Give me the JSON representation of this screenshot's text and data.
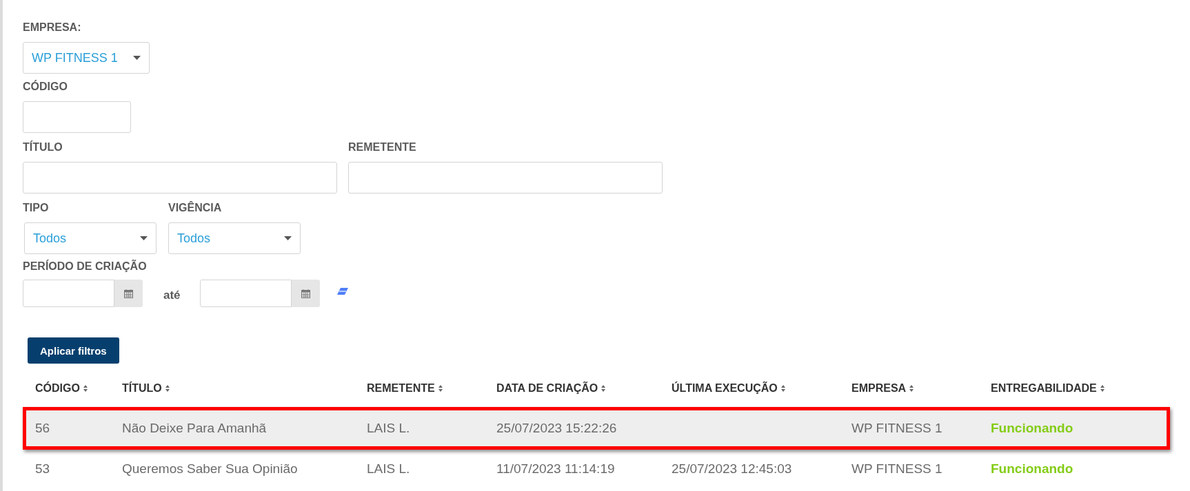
{
  "filters": {
    "empresa": {
      "label": "EMPRESA:",
      "value": "WP FITNESS 1"
    },
    "codigo": {
      "label": "CÓDIGO"
    },
    "titulo": {
      "label": "TÍTULO"
    },
    "remetente": {
      "label": "REMETENTE"
    },
    "tipo": {
      "label": "TIPO",
      "value": "Todos"
    },
    "vigencia": {
      "label": "VIGÊNCIA",
      "value": "Todos"
    },
    "periodo": {
      "label": "PERÍODO DE CRIAÇÃO",
      "separator": "até"
    },
    "apply_button": "Aplicar filtros"
  },
  "table": {
    "columns": [
      "CÓDIGO",
      "TÍTULO",
      "REMETENTE",
      "DATA DE CRIAÇÃO",
      "ÚLTIMA EXECUÇÃO",
      "EMPRESA",
      "ENTREGABILIDADE"
    ],
    "rows": [
      {
        "highlighted": true,
        "cells": [
          "56",
          "Não Deixe Para Amanhã",
          "LAIS L.",
          "25/07/2023 15:22:26",
          "",
          "WP FITNESS 1",
          "Funcionando"
        ]
      },
      {
        "highlighted": false,
        "cells": [
          "53",
          "Queremos Saber Sua Opinião",
          "LAIS L.",
          "11/07/2023 11:14:19",
          "25/07/2023 12:45:03",
          "WP FITNESS 1",
          "Funcionando"
        ]
      }
    ]
  }
}
